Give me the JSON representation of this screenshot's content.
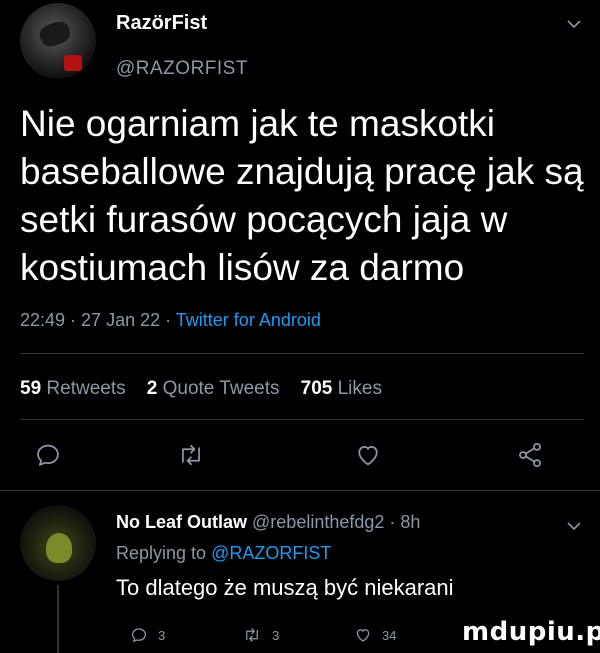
{
  "tweet": {
    "display_name": "RazörFist",
    "handle": "@RAZORFIST",
    "text": "Nie ogarniam jak te maskotki baseballowe znajdują pracę jak są setki furasów pocących jaja w kostiumach lisów za darmo",
    "time": "22:49",
    "date": "27 Jan 22",
    "source": "Twitter for Android",
    "separator": " · "
  },
  "stats": {
    "retweets_count": "59",
    "retweets_label": "Retweets",
    "quote_count": "2",
    "quote_label": "Quote Tweets",
    "likes_count": "705",
    "likes_label": "Likes"
  },
  "reply": {
    "display_name": "No Leaf Outlaw",
    "handle": "@rebelinthefdg2",
    "time_ago": "8h",
    "replying_prefix": "Replying to",
    "replying_handle": "@RAZORFIST",
    "text": "To dlatego że muszą być niekarani",
    "reply_count": "3",
    "retweet_count": "3",
    "like_count": "34"
  },
  "watermark": "mdupiu.pl",
  "icons": [
    "chevron-down-icon",
    "reply-icon",
    "retweet-icon",
    "like-icon",
    "share-icon"
  ],
  "colors": {
    "background": "#000000",
    "text": "#ffffff",
    "muted": "#8b98a5",
    "link": "#1d9bf0",
    "divider": "#2f3336"
  }
}
